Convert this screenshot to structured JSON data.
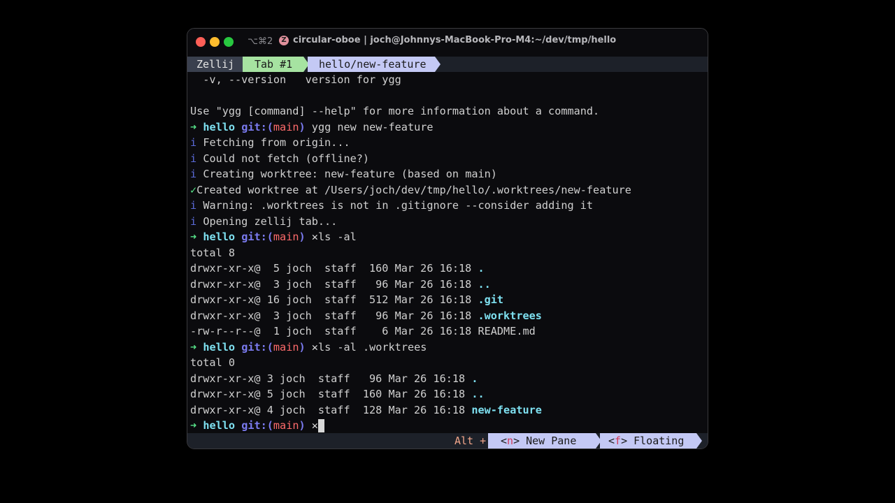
{
  "window": {
    "shortcut": "⌥⌘2",
    "title": "circular-oboe | joch@Johnnys-MacBook-Pro-M4:~/dev/tmp/hello",
    "app_icon": "zellij-z-icon"
  },
  "tabbar": {
    "brand": "Zellij",
    "tabs": [
      {
        "label": "Tab #1"
      },
      {
        "label": "hello/new-feature"
      }
    ]
  },
  "prompt": {
    "arrow": "➜",
    "dir": "hello",
    "git_prefix": "git:(",
    "branch": "main",
    "git_suffix": ")",
    "dirty": "✕"
  },
  "terminal": {
    "l0": "  -v, --version   version for ygg",
    "l1": "",
    "l2": "Use \"ygg [command] --help\" for more information about a command.",
    "cmd1": "ygg new new-feature",
    "info_icon": "i",
    "check_icon": "✓",
    "m1": "Fetching from origin...",
    "m2": "Could not fetch (offline?)",
    "m3": "Creating worktree: new-feature (based on main)",
    "m4": "Created worktree at /Users/joch/dev/tmp/hello/.worktrees/new-feature",
    "m5": "Warning: .worktrees is not in .gitignore --consider adding it",
    "m6": "Opening zellij tab...",
    "cmd2": "ls -al",
    "t1": "total 8",
    "r1a": "drwxr-xr-x@  5 joch  staff  160 Mar 26 16:18 ",
    "r1b": ".",
    "r2a": "drwxr-xr-x@  3 joch  staff   96 Mar 26 16:18 ",
    "r2b": "..",
    "r3a": "drwxr-xr-x@ 16 joch  staff  512 Mar 26 16:18 ",
    "r3b": ".git",
    "r4a": "drwxr-xr-x@  3 joch  staff   96 Mar 26 16:18 ",
    "r4b": ".worktrees",
    "r5a": "-rw-r--r--@  1 joch  staff    6 Mar 26 16:18 README.md",
    "cmd3": "ls -al .worktrees",
    "t2": "total 0",
    "s1a": "drwxr-xr-x@ 3 joch  staff   96 Mar 26 16:18 ",
    "s1b": ".",
    "s2a": "drwxr-xr-x@ 5 joch  staff  160 Mar 26 16:18 ",
    "s2b": "..",
    "s3a": "drwxr-xr-x@ 4 joch  staff  128 Mar 26 16:18 ",
    "s3b": "new-feature"
  },
  "statusbar": {
    "alt": "Alt +",
    "hint_n_open": "<",
    "hint_n_key": "n",
    "hint_n_close": "> New Pane",
    "hint_f_open": "<",
    "hint_f_key": "f",
    "hint_f_close": "> Floating"
  },
  "colors": {
    "prompt_arrow": "#57e389",
    "branch": "#ff6b6b",
    "git": "#7b7bf0",
    "tab_active": "#c4c9f5",
    "tab_green": "#a6e3a1"
  }
}
